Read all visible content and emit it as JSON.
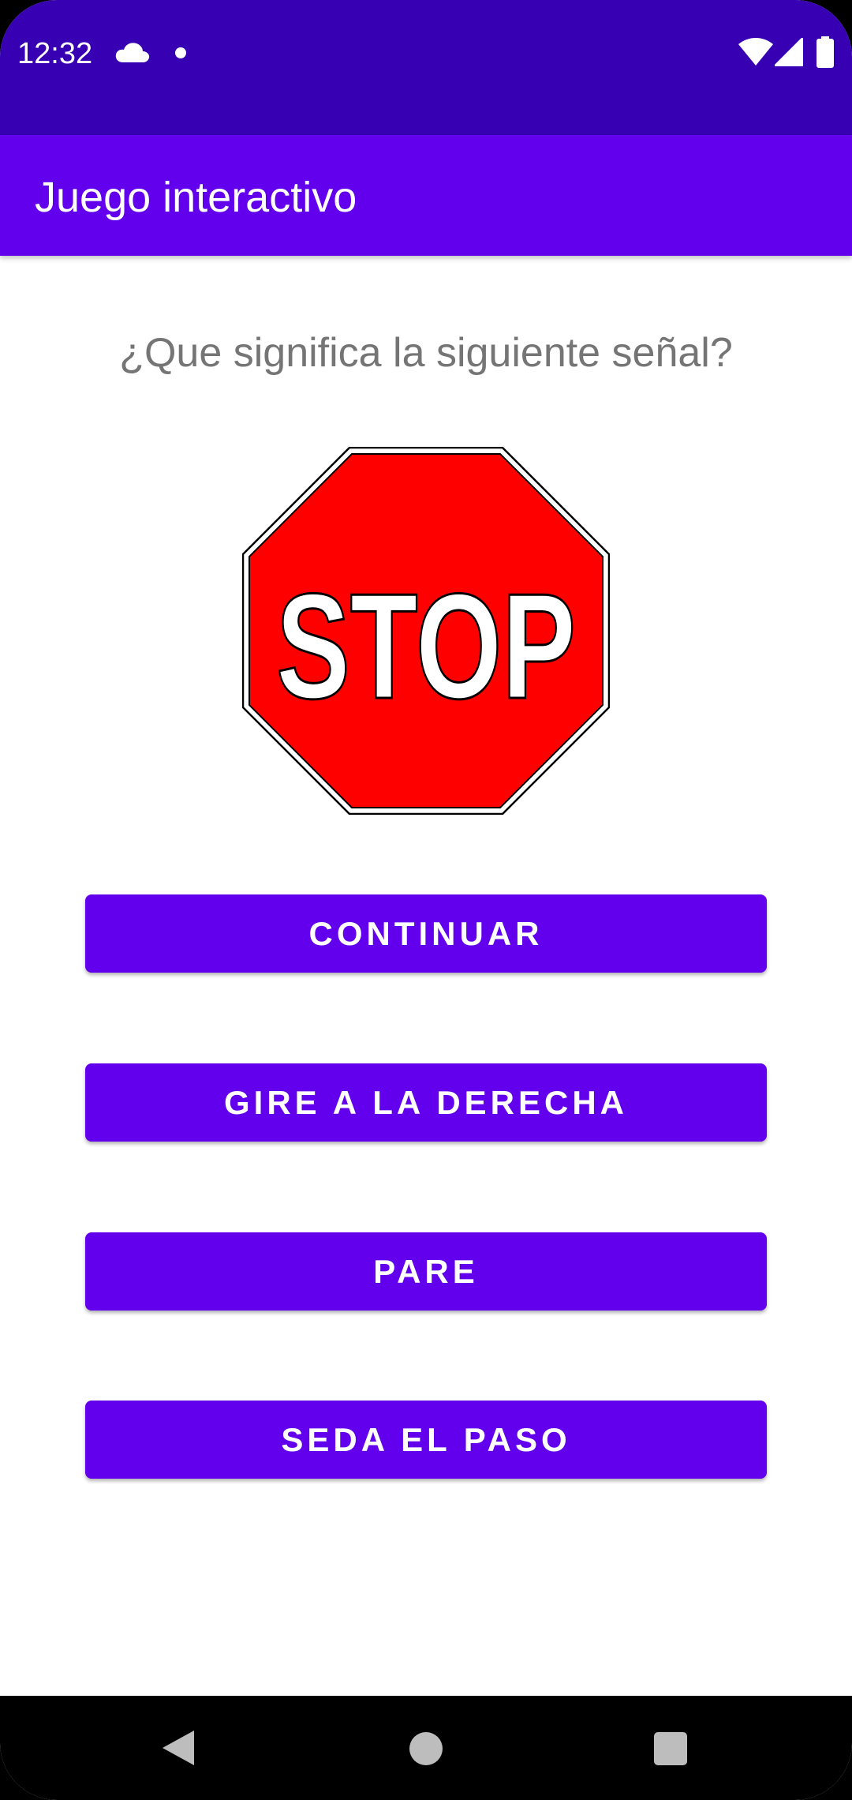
{
  "status_bar": {
    "time": "12:32",
    "icons": [
      "cloud-icon",
      "dot-icon",
      "wifi-icon",
      "signal-icon",
      "battery-icon"
    ]
  },
  "app_bar": {
    "title": "Juego interactivo",
    "color": "#6200EE"
  },
  "main": {
    "question": "¿Que significa la siguiente señal?",
    "sign_image": {
      "icon": "stop-sign-icon",
      "text": "STOP",
      "fill_color": "#FF0000"
    },
    "answers": [
      {
        "label": "CONTINUAR"
      },
      {
        "label": "GIRE A LA DERECHA"
      },
      {
        "label": "PARE"
      },
      {
        "label": "SEDA EL PASO"
      }
    ]
  },
  "nav_bar": {
    "icons": [
      "back-icon",
      "home-icon",
      "recents-icon"
    ]
  },
  "colors": {
    "status_bar": "#3700B3",
    "primary": "#6200EE",
    "question_text": "#757575"
  }
}
